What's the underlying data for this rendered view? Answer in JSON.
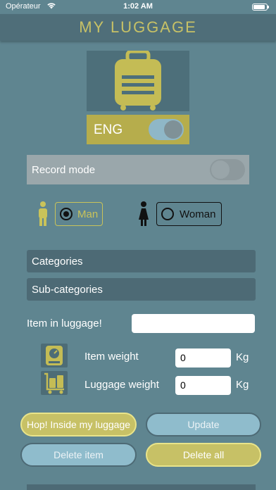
{
  "status_bar": {
    "carrier": "Opérateur",
    "time": "1:02 AM"
  },
  "header": {
    "title": "MY LUGGAGE"
  },
  "language": {
    "label": "ENG",
    "on": true
  },
  "record_mode": {
    "label": "Record mode",
    "on": false
  },
  "gender": {
    "man_label": "Man",
    "woman_label": "Woman",
    "selected": "man"
  },
  "selectors": {
    "categories": "Categories",
    "subcategories": "Sub-categories"
  },
  "item_field": {
    "label": "Item in luggage!",
    "value": ""
  },
  "item_weight": {
    "label": "Item weight",
    "value": "0",
    "unit": "Kg"
  },
  "luggage_weight": {
    "label": "Luggage weight",
    "value": "0",
    "unit": "Kg"
  },
  "buttons": {
    "add": "Hop! Inside my luggage",
    "update": "Update",
    "delete_item": "Delete item",
    "delete_all": "Delete all"
  },
  "colors": {
    "background": "#5f8590",
    "accent": "#c7c166",
    "dark_panel": "#4d6a75"
  }
}
